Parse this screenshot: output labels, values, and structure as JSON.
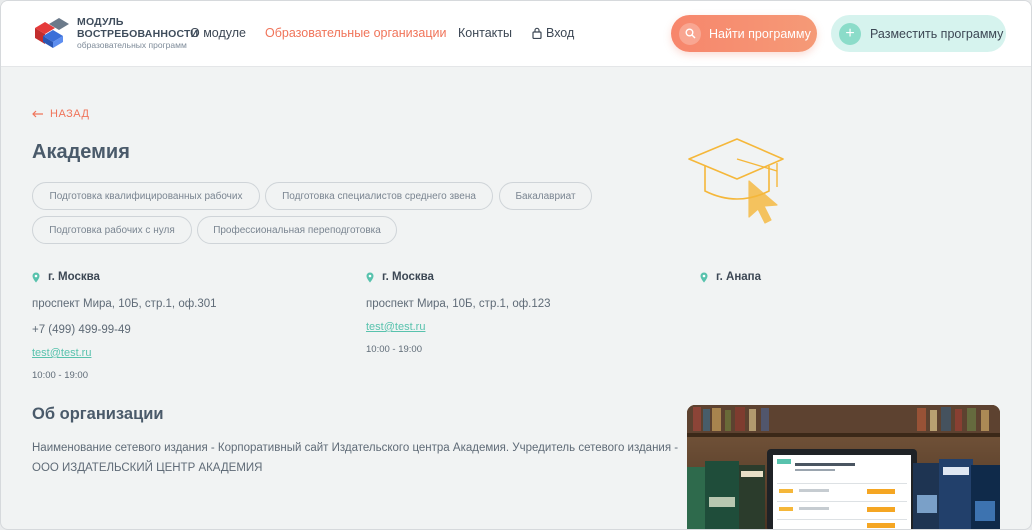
{
  "header": {
    "logo": {
      "line1": "МОДУЛЬ",
      "line2": "ВОСТРЕБОВАННОСТИ",
      "line3": "образовательных программ"
    },
    "nav": {
      "about": "О модуле",
      "orgs": "Образовательные организации",
      "contacts": "Контакты",
      "login": "Вход"
    },
    "find_button": "Найти программу",
    "place_button": "Разместить программу"
  },
  "back_label": "НАЗАД",
  "org_title": "Академия",
  "tags": [
    "Подготовка квалифицированных рабочих",
    "Подготовка специалистов среднего звена",
    "Бакалавриат",
    "Подготовка рабочих с нуля",
    "Профессиональная переподготовка"
  ],
  "addresses": [
    {
      "city": "г. Москва",
      "street": "проспект Мира, 10Б, стр.1, оф.301",
      "phone": "+7 (499) 499-99-49",
      "email": "test@test.ru",
      "hours": "10:00 - 19:00"
    },
    {
      "city": "г. Москва",
      "street": "проспект Мира, 10Б, стр.1, оф.123",
      "email": "test@test.ru",
      "hours": "10:00 - 19:00"
    },
    {
      "city": "г. Анапа"
    }
  ],
  "about": {
    "title": "Об организации",
    "text": "Наименование сетевого издания - Корпоративный сайт Издательского центра Академия. Учредитель сетевого издания - ООО ИЗДАТЕЛЬСКИЙ ЦЕНТР АКАДЕМИЯ"
  },
  "colors": {
    "accent": "#f0745a",
    "teal": "#58c2ad",
    "hat": "#f5b73a"
  },
  "icons": {
    "logo": "logo-cubes-icon",
    "lock": "lock-icon",
    "search": "search-icon",
    "plus": "plus-icon",
    "pin": "location-pin-icon",
    "back": "arrow-left-icon",
    "hat": "graduation-cap-icon"
  }
}
